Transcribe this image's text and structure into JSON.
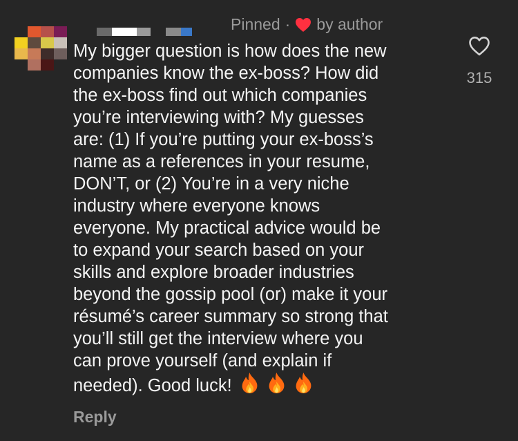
{
  "comment": {
    "pinned_label": "Pinned",
    "separator": "·",
    "liked_by_label": "by author",
    "text_lines": [
      "My bigger question is how does the new",
      "companies know the ex-boss? How did",
      "the ex-boss find out which companies",
      "you’re interviewing with? My guesses",
      "are: (1) If you’re putting your ex-boss’s",
      "name as a references in your resume,",
      "DON’T, or (2) You’re in a very niche",
      "industry where everyone knows",
      "everyone. My practical advice would be",
      "to expand your search based on your",
      "skills and explore broader industries",
      "beyond the gossip pool (or) make it your",
      "résumé’s career summary so strong that",
      "you’ll still get the interview where you",
      "can prove yourself (and explain if",
      "needed). Good luck!"
    ],
    "emoji": [
      "fire-icon",
      "fire-icon",
      "fire-icon"
    ],
    "like_count": "315",
    "reply_label": "Reply"
  },
  "colors": {
    "background": "#262626",
    "text": "#f4f4f4",
    "muted": "#9a9a9a",
    "heart_red": "#ff3040"
  }
}
